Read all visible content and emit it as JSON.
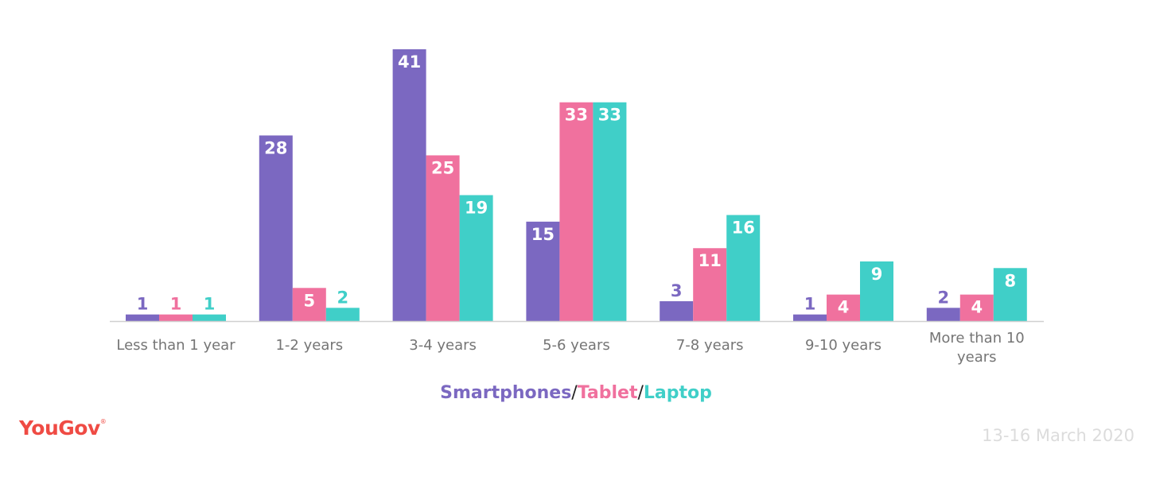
{
  "chart_data": {
    "type": "bar",
    "title": "",
    "xlabel": "",
    "ylabel": "",
    "ylim": [
      0,
      41
    ],
    "grid": false,
    "categories": [
      "Less than 1 year",
      "1-2 years",
      "3-4 years",
      "5-6 years",
      "7-8 years",
      "9-10 years",
      "More than 10 years"
    ],
    "series": [
      {
        "name": "Smartphones",
        "color": "#7b68c1",
        "values": [
          1,
          28,
          41,
          15,
          3,
          1,
          2
        ]
      },
      {
        "name": "Tablet",
        "color": "#f0719e",
        "values": [
          1,
          5,
          25,
          33,
          11,
          4,
          4
        ]
      },
      {
        "name": "Laptop",
        "color": "#40cfc8",
        "values": [
          1,
          2,
          19,
          33,
          16,
          9,
          8
        ]
      }
    ],
    "legend": {
      "placement": "bottom-center",
      "separator": "/"
    },
    "axis_color": "#d0d0d0"
  },
  "branding": {
    "logo": "YouGov",
    "logo_mark": "®",
    "logo_color": "#ef4b44"
  },
  "footer": {
    "date": "13-16 March 2020"
  }
}
